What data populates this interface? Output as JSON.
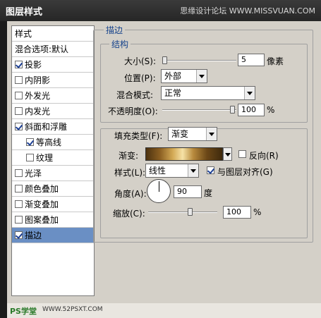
{
  "window": {
    "title": "图层样式",
    "watermark": "思缘设计论坛  WWW.MISSVUAN.COM"
  },
  "styles_list": {
    "header": "样式",
    "blend_options": "混合选项:默认",
    "items": [
      {
        "label": "投影",
        "checked": true
      },
      {
        "label": "内阴影",
        "checked": false
      },
      {
        "label": "外发光",
        "checked": false
      },
      {
        "label": "内发光",
        "checked": false
      },
      {
        "label": "斜面和浮雕",
        "checked": true
      },
      {
        "label": "等高线",
        "checked": true
      },
      {
        "label": "纹理",
        "checked": false
      },
      {
        "label": "光泽",
        "checked": false
      },
      {
        "label": "颜色叠加",
        "checked": false
      },
      {
        "label": "渐变叠加",
        "checked": false
      },
      {
        "label": "图案叠加",
        "checked": false
      },
      {
        "label": "描边",
        "checked": true
      }
    ]
  },
  "stroke": {
    "section_title": "描边",
    "structure": {
      "title": "结构",
      "size_label": "大小(S):",
      "size_value": "5",
      "size_unit": "像素",
      "position_label": "位置(P):",
      "position_value": "外部",
      "blend_mode_label": "混合模式:",
      "blend_mode_value": "正常",
      "opacity_label": "不透明度(O):",
      "opacity_value": "100",
      "opacity_unit": "%"
    },
    "fill": {
      "fill_type_label": "填充类型(F):",
      "fill_type_value": "渐变",
      "gradient_label": "渐变:",
      "reverse_label": "反向(R)",
      "style_label": "样式(L):",
      "style_value": "线性",
      "align_label": "与图层对齐(G)",
      "angle_label": "角度(A):",
      "angle_value": "90",
      "angle_unit": "度",
      "scale_label": "缩放(C):",
      "scale_value": "100",
      "scale_unit": "%"
    }
  },
  "footer": {
    "brand": "PS学堂",
    "site": "WWW.52PSXT.COM"
  },
  "colors": {
    "selection": "#6a8fc4",
    "legend_text": "#15428b"
  }
}
